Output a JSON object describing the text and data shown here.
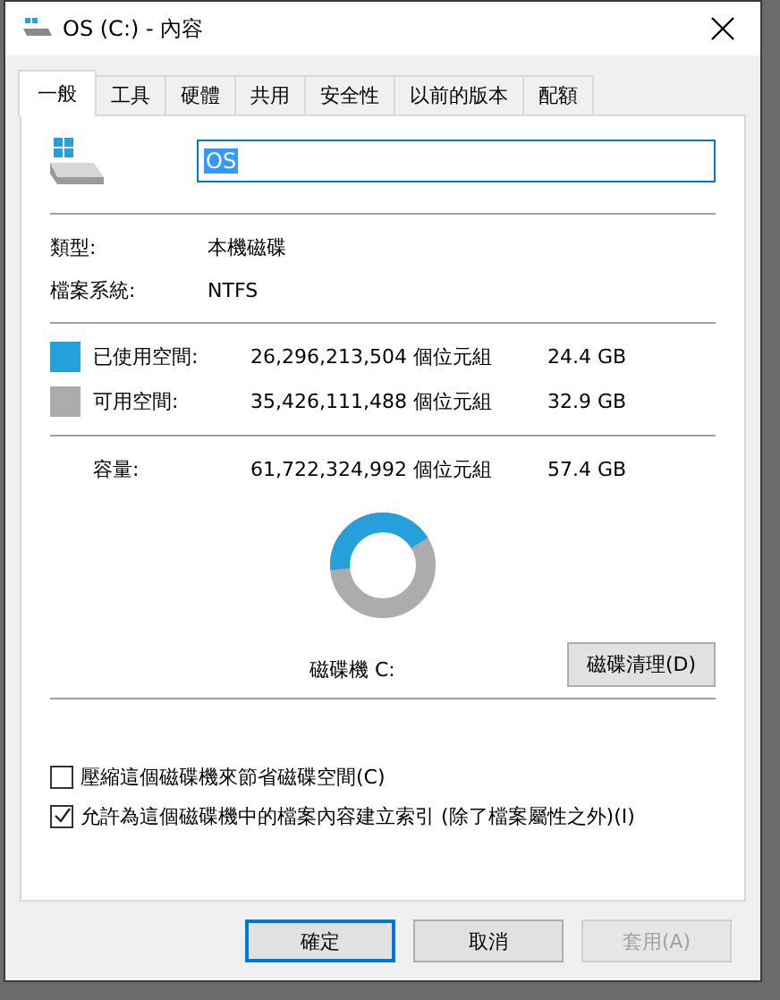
{
  "window": {
    "title": "OS (C:) - 內容"
  },
  "tabs": [
    {
      "label": "一般",
      "selected": true
    },
    {
      "label": "工具",
      "selected": false
    },
    {
      "label": "硬體",
      "selected": false
    },
    {
      "label": "共用",
      "selected": false
    },
    {
      "label": "安全性",
      "selected": false
    },
    {
      "label": "以前的版本",
      "selected": false
    },
    {
      "label": "配額",
      "selected": false
    }
  ],
  "name_field": {
    "value": "OS"
  },
  "info": [
    {
      "label": "類型:",
      "value": "本機磁碟"
    },
    {
      "label": "檔案系統:",
      "value": "NTFS"
    }
  ],
  "space": [
    {
      "label": "已使用空間:",
      "bytes": "26,296,213,504 個位元組",
      "size": "24.4 GB",
      "color": "#26a0da"
    },
    {
      "label": "可用空間:",
      "bytes": "35,426,111,488 個位元組",
      "size": "32.9 GB",
      "color": "#acacac"
    }
  ],
  "capacity": {
    "label": "容量:",
    "bytes": "61,722,324,992 個位元組",
    "size": "57.4 GB"
  },
  "drive_label": "磁碟機 C:",
  "cleanup_button": "磁碟清理(D)",
  "options": [
    {
      "label": "壓縮這個磁碟機來節省磁碟空間(C)",
      "checked": false
    },
    {
      "label": "允許為這個磁碟機中的檔案內容建立索引 (除了檔案屬性之外)(I)",
      "checked": true
    }
  ],
  "buttons": [
    {
      "label": "確定",
      "kind": "default"
    },
    {
      "label": "取消",
      "kind": "normal"
    },
    {
      "label": "套用(A)",
      "kind": "disabled"
    }
  ]
}
